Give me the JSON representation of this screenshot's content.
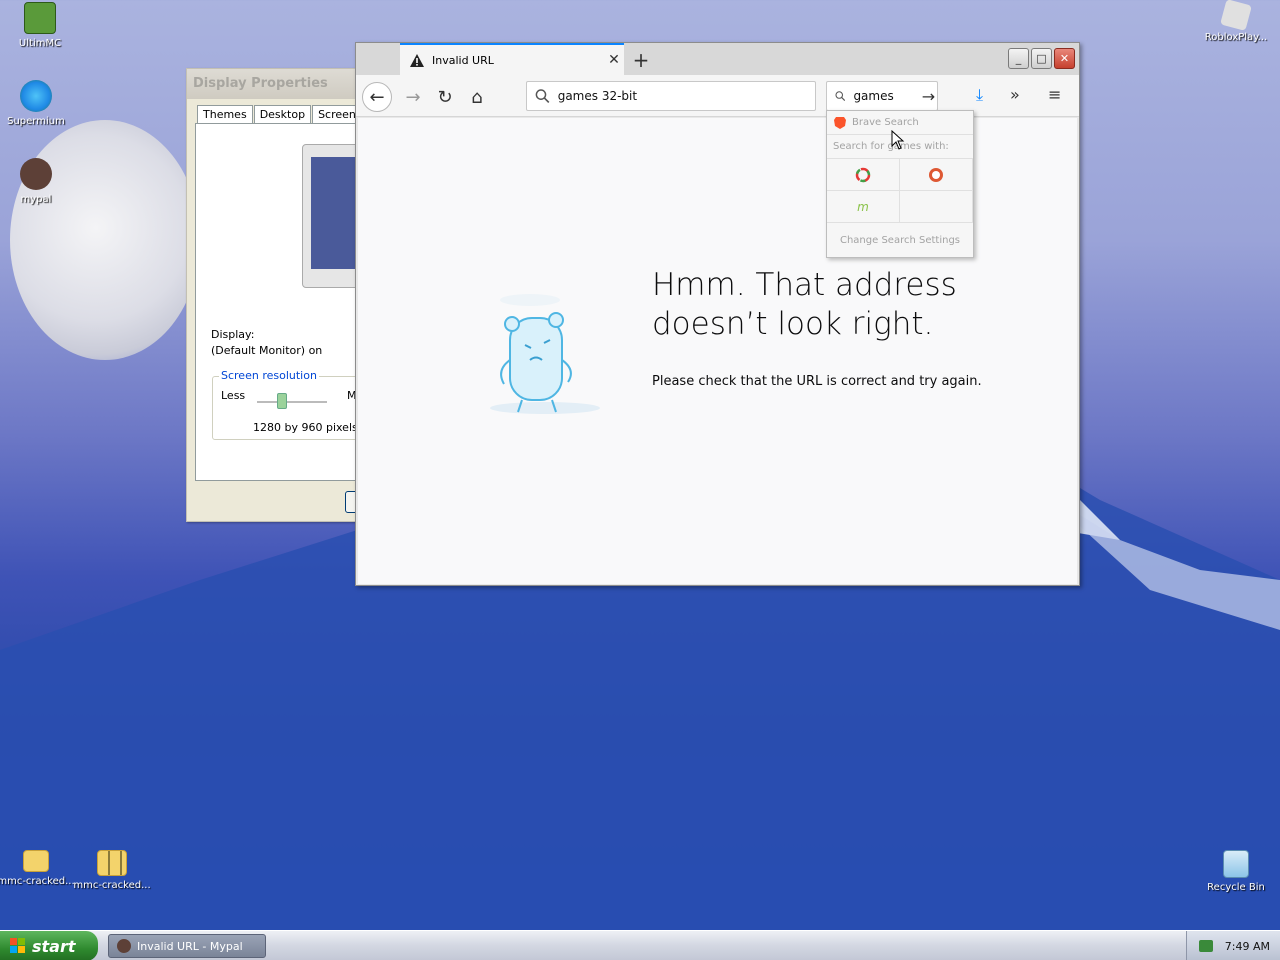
{
  "desktop": {
    "icons": [
      {
        "label": "UltimMC"
      },
      {
        "label": "Supermium"
      },
      {
        "label": "mypal"
      },
      {
        "label": "RobloxPlay..."
      },
      {
        "label": "mmc-cracked..."
      },
      {
        "label": "mmc-cracked..."
      },
      {
        "label": "Recycle Bin"
      }
    ]
  },
  "display_properties": {
    "title": "Display Properties",
    "tabs": [
      "Themes",
      "Desktop",
      "Screen Sa"
    ],
    "display_label": "Display:",
    "display_value": "(Default Monitor) on",
    "resolution_group": "Screen resolution",
    "less_label": "Less",
    "more_label": "M",
    "resolution_value": "1280 by 960 pixels"
  },
  "browser": {
    "tab_title": "Invalid URL",
    "url_value": "games 32-bit",
    "search_value": "games",
    "error_title": "Hmm. That address doesn’t look right.",
    "error_desc": "Please check that the URL is correct and try again."
  },
  "search_dropdown": {
    "engine": "Brave Search",
    "search_for": "Search for games with:",
    "footer": "Change Search Settings"
  },
  "taskbar": {
    "start_label": "start",
    "task_label": "Invalid URL - Mypal",
    "clock": "7:49 AM"
  },
  "colors": {
    "accent": "#0a84ff",
    "start_green": "#2f8a2f",
    "close_red": "#c6402e"
  }
}
